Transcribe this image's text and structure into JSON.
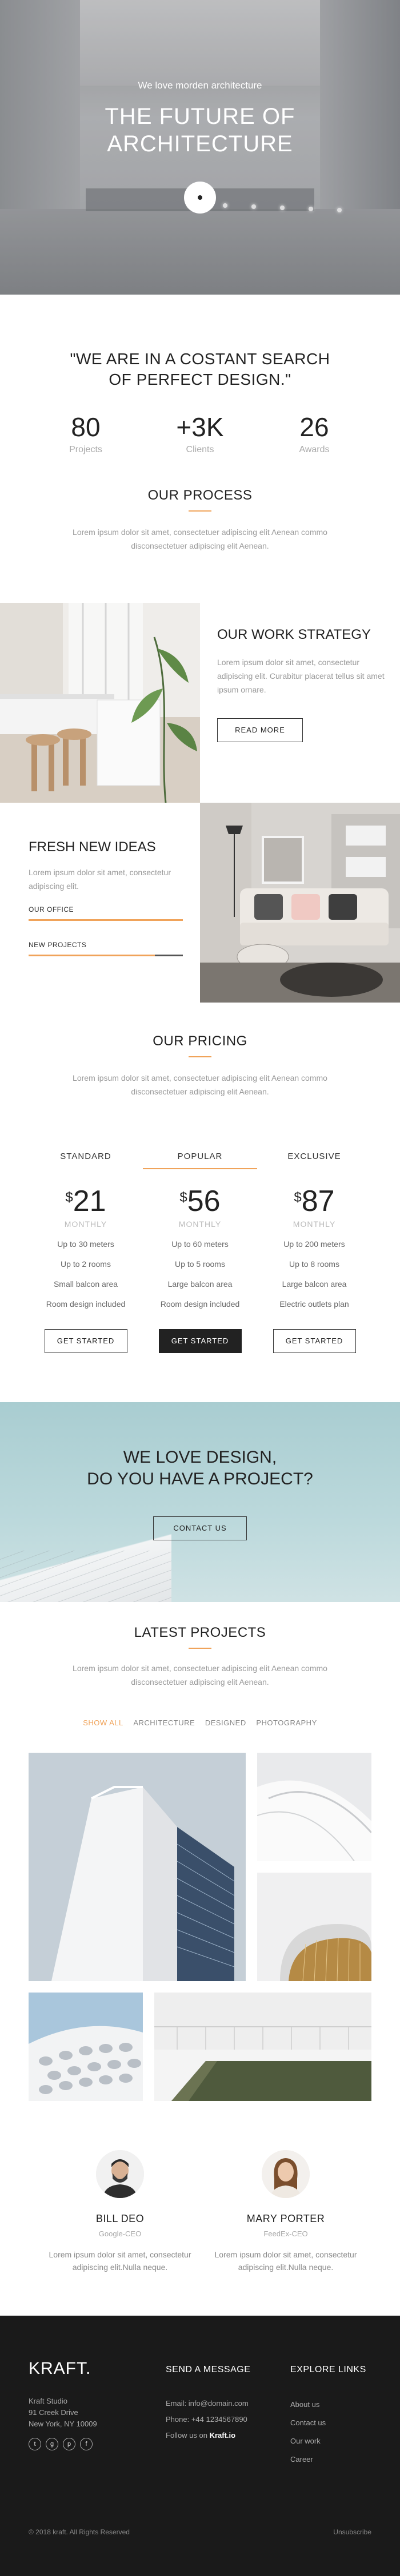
{
  "hero": {
    "subtitle": "We love morden architecture",
    "title": "THE FUTURE OF\nARCHITECTURE",
    "play_icon": "play-icon"
  },
  "quote": {
    "text": "\"WE ARE IN A COSTANT SEARCH OF PERFECT DESIGN.\""
  },
  "stats": [
    {
      "value": "80",
      "label": "Projects"
    },
    {
      "value": "+3K",
      "label": "Clients"
    },
    {
      "value": "26",
      "label": "Awards"
    }
  ],
  "process": {
    "title": "OUR PROCESS",
    "desc": "Lorem ipsum dolor sit amet, consectetuer adipiscing elit Aenean commo disconsectetuer adipiscing elit Aenean."
  },
  "strategy": {
    "title": "OUR WORK STRATEGY",
    "desc": "Lorem ipsum dolor sit amet, consectetur adipiscing elit. Curabitur placerat tellus sit amet ipsum ornare.",
    "button": "READ MORE"
  },
  "fresh": {
    "title": "FRESH NEW IDEAS",
    "desc": "Lorem ipsum dolor sit amet, consectetur adipiscing elit.",
    "skills": [
      {
        "label": "OUR OFFICE",
        "fill": 1.0
      },
      {
        "label": "NEW PROJECTS",
        "fill": 0.82
      }
    ]
  },
  "pricing": {
    "title": "OUR PRICING",
    "desc": "Lorem ipsum dolor sit amet, consectetuer adipiscing elit Aenean commo disconsectetuer adipiscing elit Aenean.",
    "plans": [
      {
        "name": "STANDARD",
        "currency": "$",
        "price": "21",
        "period": "MONTHLY",
        "features": [
          "Up to 30 meters",
          "Up to 2 rooms",
          "Small balcon area",
          "Room design included"
        ],
        "button": "GET STARTED"
      },
      {
        "name": "POPULAR",
        "currency": "$",
        "price": "56",
        "period": "MONTHLY",
        "features": [
          "Up to 60 meters",
          "Up to 5 rooms",
          "Large balcon area",
          "Room design included"
        ],
        "button": "GET STARTED"
      },
      {
        "name": "EXCLUSIVE",
        "currency": "$",
        "price": "87",
        "period": "MONTHLY",
        "features": [
          "Up to 200 meters",
          "Up to 8 rooms",
          "Large balcon area",
          "Electric outlets plan"
        ],
        "button": "GET STARTED"
      }
    ]
  },
  "cta": {
    "title": "WE LOVE DESIGN,\nDO YOU HAVE A PROJECT?",
    "button": "CONTACT US"
  },
  "projects": {
    "title": "LATEST PROJECTS",
    "desc": "Lorem ipsum dolor sit amet, consectetuer adipiscing elit Aenean commo disconsectetuer adipiscing elit Aenean.",
    "filters": [
      "SHOW ALL",
      "ARCHITECTURE",
      "DESIGNED",
      "PHOTOGRAPHY"
    ]
  },
  "team": [
    {
      "name": "BILL DEO",
      "role": "Google-CEO",
      "desc": "Lorem ipsum dolor sit amet, consectetur adipiscing elit.Nulla neque."
    },
    {
      "name": "MARY PORTER",
      "role": "FeedEx-CEO",
      "desc": "Lorem ipsum dolor sit amet, consectetur adipiscing elit.Nulla neque."
    }
  ],
  "footer": {
    "logo": "KRAFT.",
    "address": [
      "Kraft Studio",
      "91 Creek Drive",
      "New York, NY 10009"
    ],
    "social_icons": [
      "twitter-icon",
      "google-plus-icon",
      "pinterest-icon",
      "facebook-icon"
    ],
    "social_glyphs": [
      "t",
      "g",
      "p",
      "f"
    ],
    "contact_title": "SEND A MESSAGE",
    "email": "Email: info@domain.com",
    "phone": "Phone: +44 1234567890",
    "follow_prefix": "Follow us on ",
    "follow_brand": "Kraft.io",
    "links_title": "EXPLORE LINKS",
    "links": [
      "About us",
      "Contact us",
      "Our work",
      "Career"
    ],
    "copyright": "© 2018 kraft. All Rights Reserved",
    "unsubscribe": "Unsubscribe"
  },
  "colors": {
    "accent": "#f0a35a",
    "dark": "#222222",
    "footer_bg": "#1a1a1a"
  }
}
